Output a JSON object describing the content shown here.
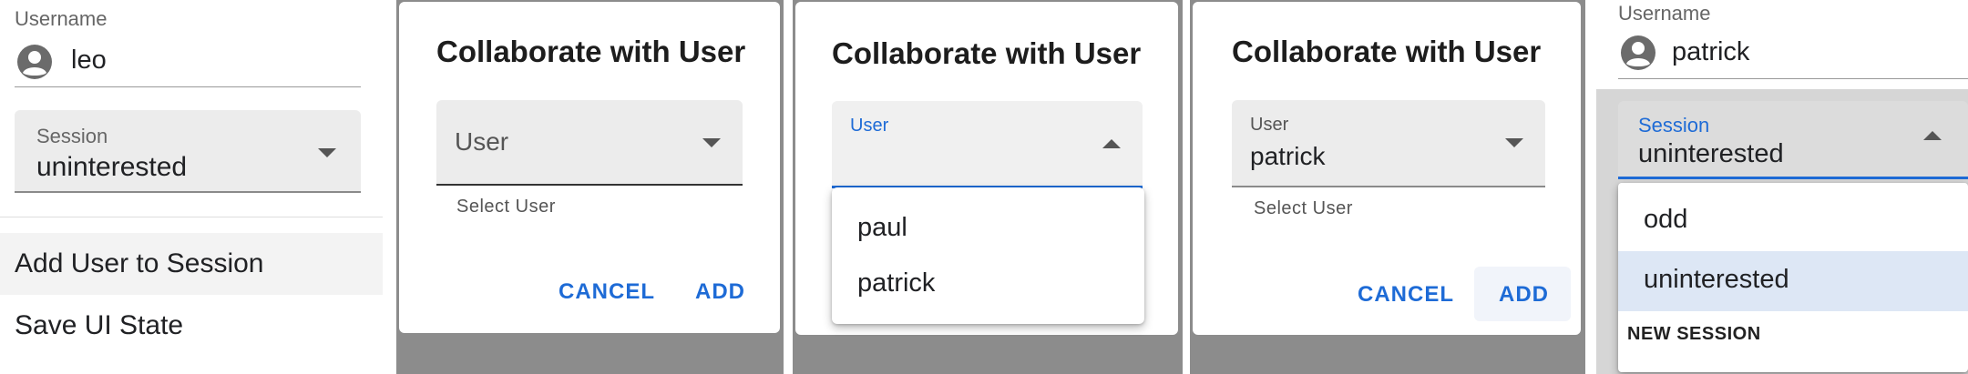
{
  "panel1": {
    "username_label": "Username",
    "username_value": "leo",
    "session_label": "Session",
    "session_value": "uninterested",
    "menu": [
      "Add User to Session",
      "Save UI State"
    ]
  },
  "panel2": {
    "title": "Collaborate with User",
    "user_placeholder": "User",
    "helper": "Select User",
    "cancel": "CANCEL",
    "add": "ADD"
  },
  "panel3": {
    "title": "Collaborate with User",
    "user_label": "User",
    "options": [
      "paul",
      "patrick"
    ]
  },
  "panel4": {
    "title": "Collaborate with User",
    "user_label": "User",
    "user_value": "patrick",
    "helper": "Select User",
    "cancel": "CANCEL",
    "add": "ADD"
  },
  "panel5": {
    "username_label": "Username",
    "username_value": "patrick",
    "session_label": "Session",
    "session_value": "uninterested",
    "options": [
      "odd",
      "uninterested"
    ],
    "new_session": "NEW SESSION"
  },
  "colors": {
    "accent": "#1e6bd6",
    "selected_bg": "#dde7f5",
    "filled_bg": "#ececec"
  }
}
